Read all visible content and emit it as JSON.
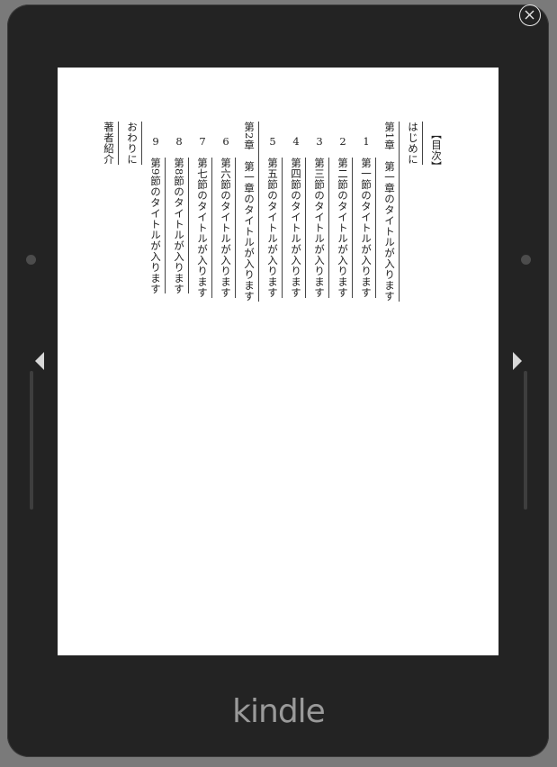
{
  "device": {
    "brand": "kindle"
  },
  "icons": {
    "close": "close-icon",
    "prev": "triangle-left-icon",
    "next": "triangle-right-icon"
  },
  "toc": {
    "title": "【目次】",
    "entries": [
      {
        "kind": "plain",
        "num": "",
        "text": "はじめに"
      },
      {
        "kind": "chapter",
        "num": "",
        "text": "第1章　第一章のタイトルが入ります"
      },
      {
        "kind": "section",
        "num": "1",
        "text": "第一節のタイトルが入ります"
      },
      {
        "kind": "section",
        "num": "2",
        "text": "第二節のタイトルが入ります"
      },
      {
        "kind": "section",
        "num": "3",
        "text": "第三節のタイトルが入ります"
      },
      {
        "kind": "section",
        "num": "4",
        "text": "第四節のタイトルが入ります"
      },
      {
        "kind": "section",
        "num": "5",
        "text": "第五節のタイトルが入ります"
      },
      {
        "kind": "chapter",
        "num": "",
        "text": "第2章　第一章のタイトルが入ります"
      },
      {
        "kind": "section",
        "num": "6",
        "text": "第六節のタイトルが入ります"
      },
      {
        "kind": "section",
        "num": "7",
        "text": "第七節のタイトルが入ります"
      },
      {
        "kind": "section",
        "num": "8",
        "text": "第8節のタイトルが入ります"
      },
      {
        "kind": "section",
        "num": "9",
        "text": "第9節のタイトルが入ります"
      },
      {
        "kind": "plain",
        "num": "",
        "text": "おわりに"
      },
      {
        "kind": "plain",
        "num": "",
        "text": "著者紹介"
      }
    ]
  }
}
